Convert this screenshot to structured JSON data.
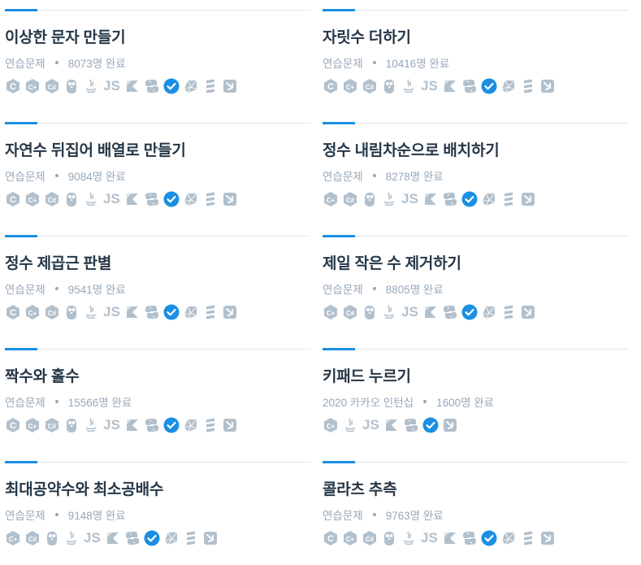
{
  "cards": [
    {
      "title": "이상한 문자 만들기",
      "category": "연습문제",
      "completed": "8073명 완료",
      "languages": [
        "c-icon",
        "cpp-icon",
        "csharp-icon",
        "go-icon",
        "java-icon",
        "javascript-icon",
        "kotlin-icon",
        "python-icon",
        "python3-icon",
        "ruby-icon",
        "scala-icon",
        "swift-icon"
      ]
    },
    {
      "title": "자릿수 더하기",
      "category": "연습문제",
      "completed": "10416명 완료",
      "languages": [
        "c-icon",
        "cpp-icon",
        "csharp-icon",
        "go-icon",
        "java-icon",
        "javascript-icon",
        "kotlin-icon",
        "python-icon",
        "python3-icon",
        "ruby-icon",
        "scala-icon",
        "swift-icon"
      ]
    },
    {
      "title": "자연수 뒤집어 배열로 만들기",
      "category": "연습문제",
      "completed": "9084명 완료",
      "languages": [
        "c-icon",
        "cpp-icon",
        "csharp-icon",
        "go-icon",
        "java-icon",
        "javascript-icon",
        "kotlin-icon",
        "python-icon",
        "python3-icon",
        "ruby-icon",
        "scala-icon",
        "swift-icon"
      ]
    },
    {
      "title": "정수 내림차순으로 배치하기",
      "category": "연습문제",
      "completed": "8278명 완료",
      "languages": [
        "cpp-icon",
        "csharp-icon",
        "go-icon",
        "java-icon",
        "javascript-icon",
        "kotlin-icon",
        "python-icon",
        "python3-icon",
        "ruby-icon",
        "scala-icon",
        "swift-icon"
      ]
    },
    {
      "title": "정수 제곱근 판별",
      "category": "연습문제",
      "completed": "9541명 완료",
      "languages": [
        "c-icon",
        "cpp-icon",
        "csharp-icon",
        "go-icon",
        "java-icon",
        "javascript-icon",
        "kotlin-icon",
        "python-icon",
        "python3-icon",
        "ruby-icon",
        "scala-icon",
        "swift-icon"
      ]
    },
    {
      "title": "제일 작은 수 제거하기",
      "category": "연습문제",
      "completed": "8805명 완료",
      "languages": [
        "cpp-icon",
        "csharp-icon",
        "go-icon",
        "java-icon",
        "javascript-icon",
        "kotlin-icon",
        "python-icon",
        "python3-icon",
        "ruby-icon",
        "scala-icon",
        "swift-icon"
      ]
    },
    {
      "title": "짝수와 홀수",
      "category": "연습문제",
      "completed": "15566명 완료",
      "languages": [
        "c-icon",
        "cpp-icon",
        "csharp-icon",
        "go-icon",
        "java-icon",
        "javascript-icon",
        "kotlin-icon",
        "python-icon",
        "python3-icon",
        "ruby-icon",
        "scala-icon",
        "swift-icon"
      ]
    },
    {
      "title": "키패드 누르기",
      "category": "2020 카카오 인턴십",
      "completed": "1600명 완료",
      "languages": [
        "cpp-icon",
        "java-icon",
        "javascript-icon",
        "kotlin-icon",
        "python-icon",
        "python3-icon",
        "swift-icon"
      ]
    },
    {
      "title": "최대공약수와 최소공배수",
      "category": "연습문제",
      "completed": "9148명 완료",
      "languages": [
        "cpp-icon",
        "csharp-icon",
        "go-icon",
        "java-icon",
        "javascript-icon",
        "kotlin-icon",
        "python-icon",
        "python3-icon",
        "ruby-icon",
        "scala-icon",
        "swift-icon"
      ]
    },
    {
      "title": "콜라츠 추측",
      "category": "연습문제",
      "completed": "9763명 완료",
      "languages": [
        "c-icon",
        "cpp-icon",
        "csharp-icon",
        "go-icon",
        "java-icon",
        "javascript-icon",
        "kotlin-icon",
        "python-icon",
        "python3-icon",
        "ruby-icon",
        "scala-icon",
        "swift-icon"
      ]
    }
  ],
  "icon_text": {
    "javascript-icon": "JS"
  },
  "colors": {
    "accent": "#1a8fe3",
    "icon": "#b2c0cc",
    "python3_check": "#1a8fe3",
    "title": "#263747",
    "meta": "#98a8b9"
  }
}
